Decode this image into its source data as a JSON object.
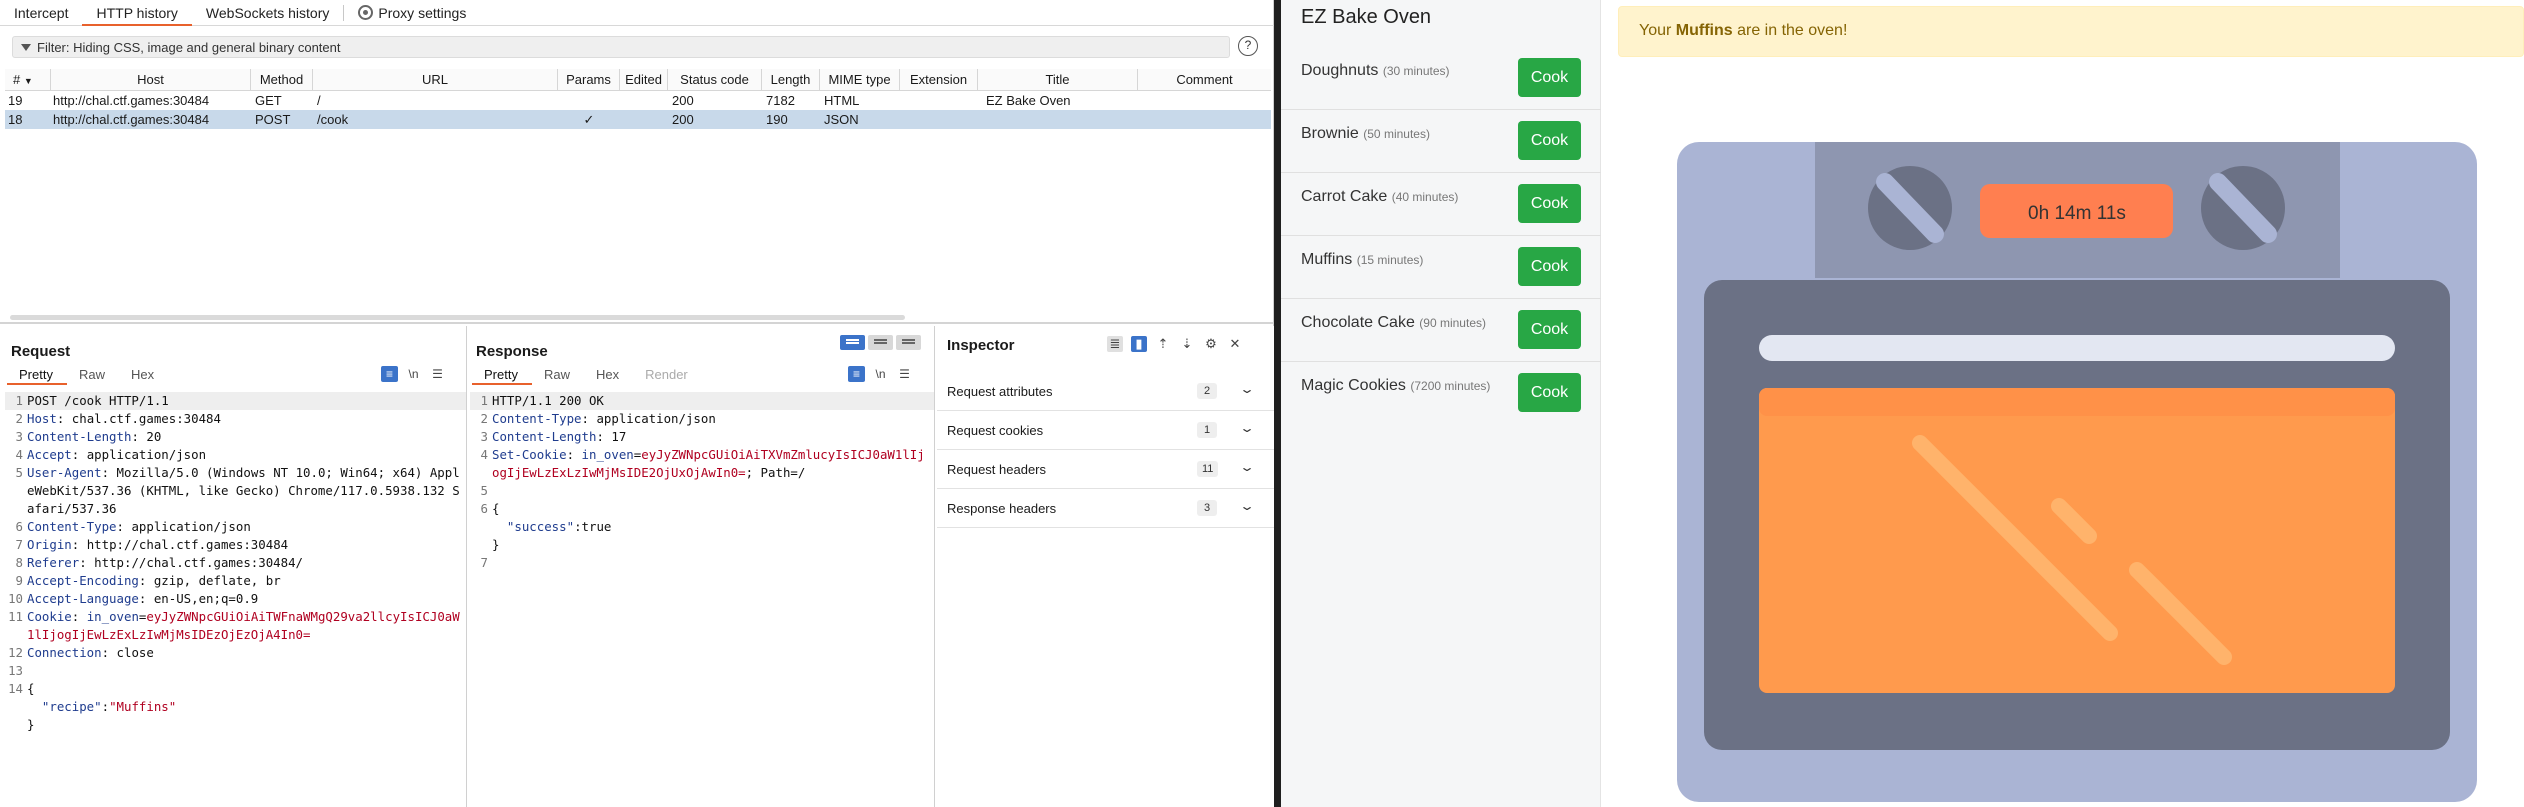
{
  "burp": {
    "tabs": [
      "Intercept",
      "HTTP history",
      "WebSockets history",
      "Proxy settings"
    ],
    "filter": "Filter: Hiding CSS, image and general binary content",
    "help": "?",
    "columns": [
      "#",
      "Host",
      "Method",
      "URL",
      "Params",
      "Edited",
      "Status code",
      "Length",
      "MIME type",
      "Extension",
      "Title",
      "Comment"
    ],
    "rows": [
      {
        "num": "19",
        "host": "http://chal.ctf.games:30484",
        "method": "GET",
        "url": "/",
        "params": "",
        "edited": "",
        "status": "200",
        "length": "7182",
        "mime": "HTML",
        "ext": "",
        "title": "EZ Bake Oven",
        "comment": ""
      },
      {
        "num": "18",
        "host": "http://chal.ctf.games:30484",
        "method": "POST",
        "url": "/cook",
        "params": "✓",
        "edited": "",
        "status": "200",
        "length": "190",
        "mime": "JSON",
        "ext": "",
        "title": "",
        "comment": ""
      }
    ],
    "request": {
      "title": "Request",
      "tabs": [
        "Pretty",
        "Raw",
        "Hex"
      ],
      "lines": [
        {
          "n": "1",
          "k": "",
          "v": "POST /cook HTTP/1.1"
        },
        {
          "n": "2",
          "k": "Host",
          "v": " chal.ctf.games:30484"
        },
        {
          "n": "3",
          "k": "Content-Length",
          "v": " 20"
        },
        {
          "n": "4",
          "k": "Accept",
          "v": " application/json"
        },
        {
          "n": "5",
          "k": "User-Agent",
          "v": " Mozilla/5.0 (Windows NT 10.0; Win64; x64) AppleWebKit/537.36 (KHTML, like Gecko) Chrome/117.0.5938.132 Safari/537.36"
        },
        {
          "n": "6",
          "k": "Content-Type",
          "v": " application/json"
        },
        {
          "n": "7",
          "k": "Origin",
          "v": " http://chal.ctf.games:30484"
        },
        {
          "n": "8",
          "k": "Referer",
          "v": " http://chal.ctf.games:30484/"
        },
        {
          "n": "9",
          "k": "Accept-Encoding",
          "v": " gzip, deflate, br"
        },
        {
          "n": "10",
          "k": "Accept-Language",
          "v": " en-US,en;q=0.9"
        },
        {
          "n": "11",
          "k": "Cookie",
          "v": " ",
          "ck": "in_oven",
          "cv": "eyJyZWNpcGUiOiAiTWFnaWMgQ29va2llcyIsICJ0aW1lIjogIjEwLzExLzIwMjMsIDEzOjEzOjA4In0="
        },
        {
          "n": "12",
          "k": "Connection",
          "v": " close"
        },
        {
          "n": "13",
          "k": "",
          "v": ""
        },
        {
          "n": "14",
          "k": "",
          "v": "{"
        },
        {
          "n": "",
          "k": "",
          "v": "  ",
          "jk": "\"recipe\"",
          "js": "\"Muffins\""
        },
        {
          "n": "",
          "k": "",
          "v": "}"
        }
      ]
    },
    "response": {
      "title": "Response",
      "tabs": [
        "Pretty",
        "Raw",
        "Hex",
        "Render"
      ],
      "lines": [
        {
          "n": "1",
          "k": "",
          "v": "HTTP/1.1 200 OK"
        },
        {
          "n": "2",
          "k": "Content-Type",
          "v": " application/json"
        },
        {
          "n": "3",
          "k": "Content-Length",
          "v": " 17"
        },
        {
          "n": "4",
          "k": "Set-Cookie",
          "v": " ",
          "ck": "in_oven",
          "cv": "eyJyZWNpcGUiOiAiTXVmZmlucyIsICJ0aW1lIjogIjEwLzExLzIwMjMsIDE2OjUxOjAwIn0=",
          "tail": "; Path=/"
        },
        {
          "n": "5",
          "k": "",
          "v": ""
        },
        {
          "n": "6",
          "k": "",
          "v": "{"
        },
        {
          "n": "",
          "k": "",
          "v": "  ",
          "jk": "\"success\"",
          "jv": "true"
        },
        {
          "n": "",
          "k": "",
          "v": "}"
        },
        {
          "n": "7",
          "k": "",
          "v": ""
        }
      ]
    },
    "inspector": {
      "title": "Inspector",
      "rows": [
        {
          "label": "Request attributes",
          "count": "2"
        },
        {
          "label": "Request cookies",
          "count": "1"
        },
        {
          "label": "Request headers",
          "count": "11"
        },
        {
          "label": "Response headers",
          "count": "3"
        }
      ]
    }
  },
  "app": {
    "title": "EZ Bake Oven",
    "recipes": [
      {
        "name": "Doughnuts",
        "time": "(30 minutes)",
        "button": "Cook"
      },
      {
        "name": "Brownie",
        "time": "(50 minutes)",
        "button": "Cook"
      },
      {
        "name": "Carrot Cake",
        "time": "(40 minutes)",
        "button": "Cook"
      },
      {
        "name": "Muffins",
        "time": "(15 minutes)",
        "button": "Cook"
      },
      {
        "name": "Chocolate Cake",
        "time": "(90 minutes)",
        "button": "Cook"
      },
      {
        "name": "Magic Cookies",
        "time": "(7200 minutes)",
        "button": "Cook"
      }
    ],
    "alert": {
      "prefix": "Your ",
      "item": "Muffins",
      "suffix": " are in the oven!"
    },
    "timer": "0h 14m 11s",
    "colors": {
      "cook": "#28a745",
      "timer": "#ff7f50",
      "oven_body": "#aab4d4",
      "oven_door": "#6b7185",
      "window": "#ff9a4d"
    }
  }
}
